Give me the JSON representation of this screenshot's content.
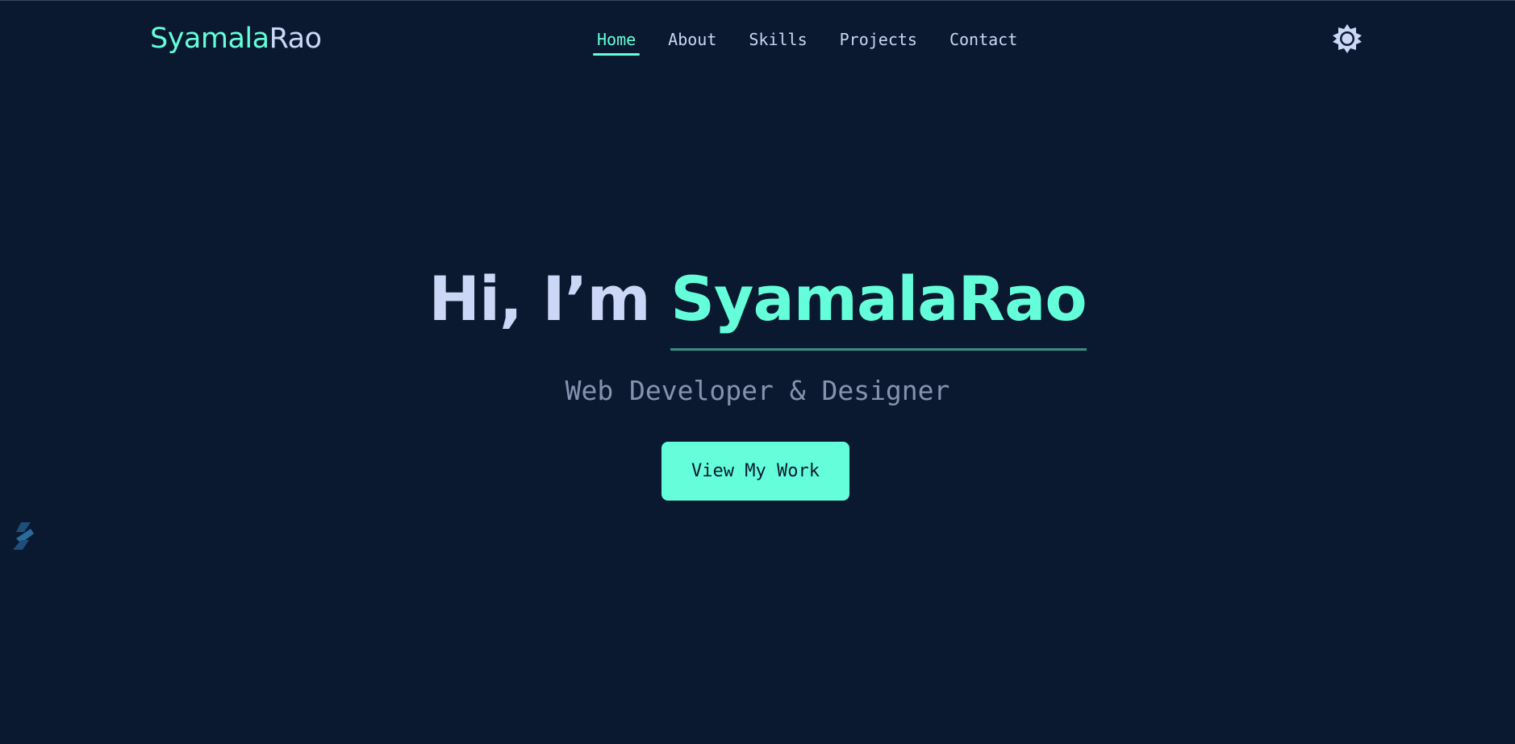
{
  "header": {
    "logo_part_a": "Syamala",
    "logo_part_b": "Rao",
    "nav": [
      {
        "label": "Home",
        "active": true
      },
      {
        "label": "About",
        "active": false
      },
      {
        "label": "Skills",
        "active": false
      },
      {
        "label": "Projects",
        "active": false
      },
      {
        "label": "Contact",
        "active": false
      }
    ],
    "theme_toggle_icon": "sun-icon"
  },
  "hero": {
    "greeting": "Hi, I’m ",
    "name": "SyamalaRao",
    "subtitle": "Web Developer & Designer",
    "cta_label": "View My Work"
  },
  "side_logo_icon": "s-logo-icon",
  "colors": {
    "background": "#0a192f",
    "accent": "#64ffda",
    "heading": "#ccd6f6",
    "muted": "#8892b0"
  }
}
